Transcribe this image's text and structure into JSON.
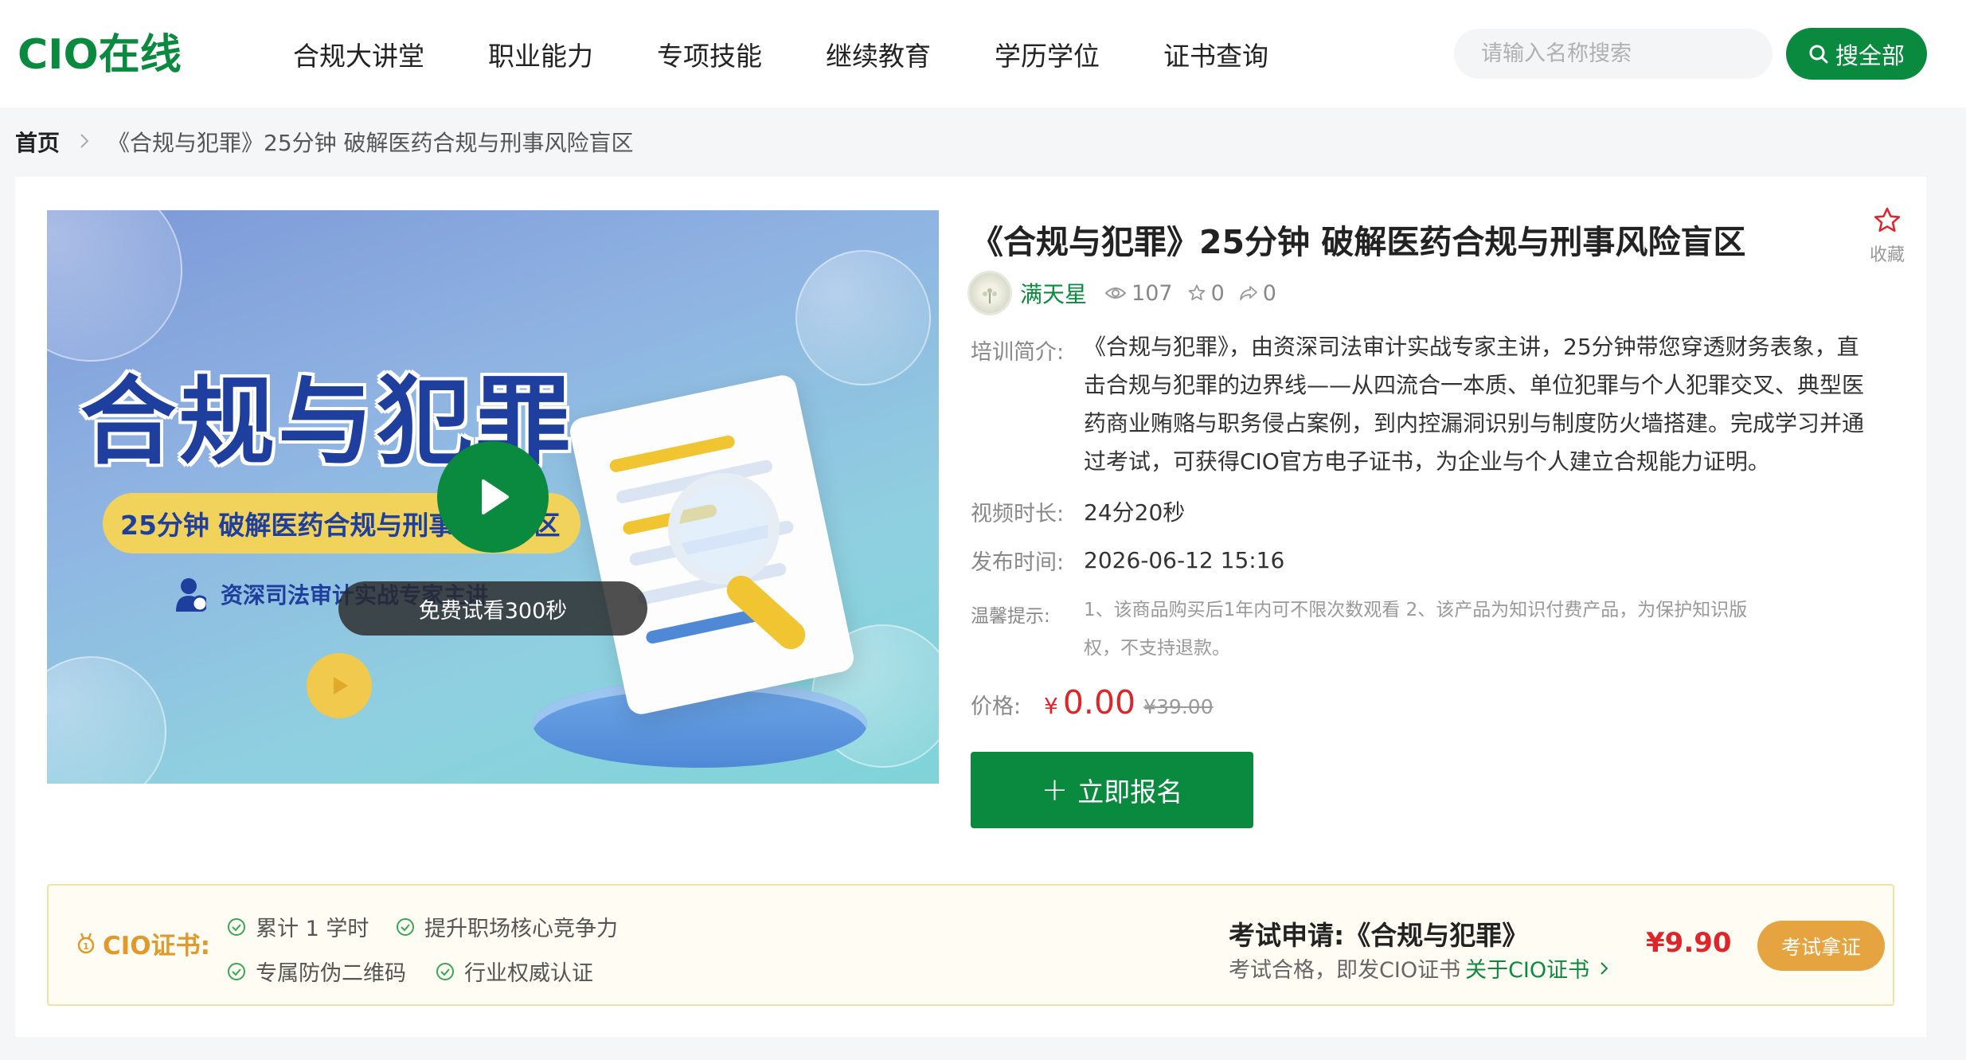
{
  "header": {
    "logo_text": "CIO在线",
    "nav": [
      "合规大讲堂",
      "职业能力",
      "专项技能",
      "继续教育",
      "学历学位",
      "证书查询"
    ],
    "search_placeholder": "请输入名称搜索",
    "search_button": "搜全部"
  },
  "breadcrumb": {
    "home": "首页",
    "current": "《合规与犯罪》25分钟 破解医药合规与刑事风险盲区"
  },
  "video": {
    "cover_title": "合规与犯罪",
    "cover_subtitle": "25分钟 破解医药合规与刑事风险盲区",
    "cover_speaker": "资深司法审计实战专家主讲",
    "trial_label": "免费试看300秒"
  },
  "course": {
    "title": "《合规与犯罪》25分钟 破解医药合规与刑事风险盲区",
    "favorite_label": "收藏",
    "author": "满天星",
    "views": "107",
    "stars": "0",
    "shares": "0",
    "intro_label": "培训简介:",
    "intro_text": "《合规与犯罪》，由资深司法审计实战专家主讲，25分钟带您穿透财务表象，直击合规与犯罪的边界线——从四流合一本质、单位犯罪与个人犯罪交叉、典型医药商业贿赂与职务侵占案例，到内控漏洞识别与制度防火墙搭建。完成学习并通过考试，可获得CIO官方电子证书，为企业与个人建立合规能力证明。",
    "duration_label": "视频时长:",
    "duration": "24分20秒",
    "publish_label": "发布时间:",
    "publish_time": "2026-06-12 15:16",
    "tip_label": "温馨提示:",
    "tip_text": "1、该商品购买后1年内可不限次数观看 2、该产品为知识付费产品，为保护知识版权，不支持退款。",
    "price_label": "价格:",
    "currency": "¥",
    "price": "0.00",
    "original_price": "¥39.00",
    "enroll_button": "立即报名"
  },
  "certificate": {
    "label": "CIO证书:",
    "features": [
      "累计 1 学时",
      "提升职场核心竞争力",
      "专属防伪二维码",
      "行业权威认证"
    ],
    "exam_title": "考试申请:《合规与犯罪》",
    "exam_sub": "考试合格，即发CIO证书",
    "about_link": "关于CIO证书",
    "exam_price": "¥9.90",
    "exam_button": "考试拿证"
  },
  "colors": {
    "brand_green": "#0a8a3e",
    "price_red": "#e0252a",
    "cert_orange": "#e5a43f"
  }
}
